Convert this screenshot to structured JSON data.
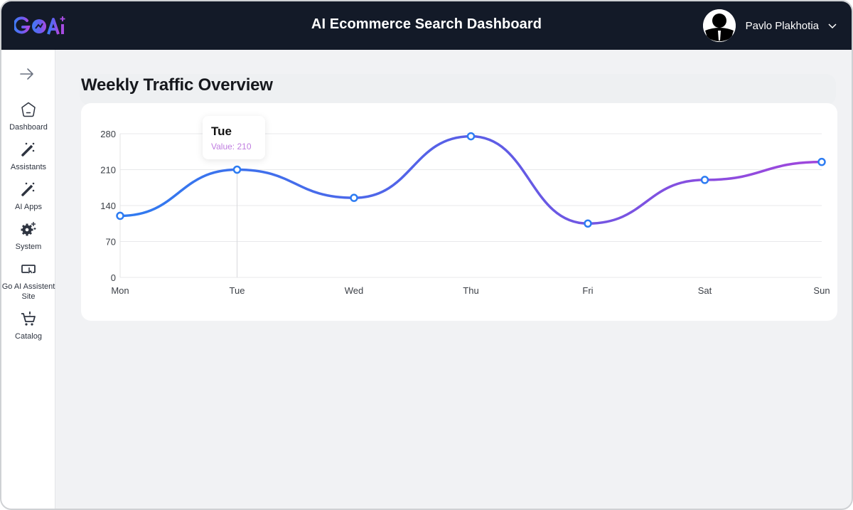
{
  "header": {
    "logo_text": "GOAi",
    "title": "AI Ecommerce Search Dashboard",
    "user_name": "Pavlo Plakhotia"
  },
  "sidebar": {
    "toggle_icon": "arrow-right-icon",
    "items": [
      {
        "label": "Dashboard",
        "icon": "home-pentagon-icon"
      },
      {
        "label": "Assistants",
        "icon": "magic-wand-icon"
      },
      {
        "label": "AI Apps",
        "icon": "magic-wand-icon"
      },
      {
        "label": "System",
        "icon": "gear-sparkle-icon"
      },
      {
        "label": "Go AI Assistent Site",
        "icon": "browser-cursor-icon"
      },
      {
        "label": "Catalog",
        "icon": "cart-icon"
      }
    ]
  },
  "main": {
    "section_title": "Weekly Traffic Overview"
  },
  "tooltip": {
    "title": "Tue",
    "value_text": "Value: 210"
  },
  "colors": {
    "topbar": "#131a28",
    "line_start": "#2f7bf0",
    "line_mid": "#5a5ee6",
    "line_end": "#a046dc",
    "point_stroke": "#2d7cf2",
    "tooltip_value": "#c07ee0"
  },
  "chart_data": {
    "type": "line",
    "title": "Weekly Traffic Overview",
    "xlabel": "",
    "ylabel": "",
    "categories": [
      "Mon",
      "Tue",
      "Wed",
      "Thu",
      "Fri",
      "Sat",
      "Sun"
    ],
    "series": [
      {
        "name": "Value",
        "values": [
          120,
          210,
          155,
          275,
          105,
          190,
          225
        ]
      }
    ],
    "yticks": [
      0,
      70,
      140,
      210,
      280
    ],
    "ylim": [
      0,
      280
    ],
    "grid": "horizontal",
    "curve": "smooth",
    "active_point": "Tue"
  }
}
